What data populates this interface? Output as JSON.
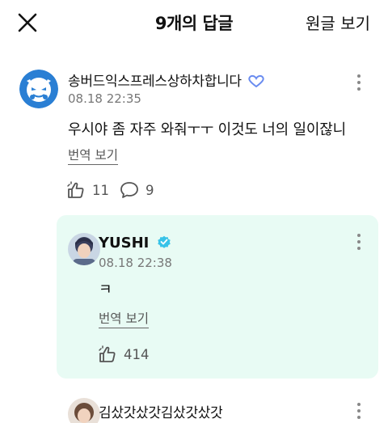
{
  "header": {
    "title": "9개의 답글",
    "view_original": "원글 보기"
  },
  "comments": [
    {
      "author": "송버드익스프레스상하차합니다",
      "timestamp": "08.18 22:35",
      "text": "우시야 좀 자주 와줘ㅜㅜ 이것도 너의 일이잖니",
      "translate": "번역 보기",
      "likes": "11",
      "replies": "9"
    },
    {
      "author": "YUSHI",
      "verified": true,
      "timestamp": "08.18 22:38",
      "text": "ㅋ",
      "translate": "번역 보기",
      "likes": "414"
    },
    {
      "author": "김샀갓샀갓김샀갓샀갓"
    }
  ],
  "colors": {
    "reply_bg": "#e8fbf4",
    "verified": "#38c3e8",
    "avatar_blue": "#2a7fd4"
  }
}
